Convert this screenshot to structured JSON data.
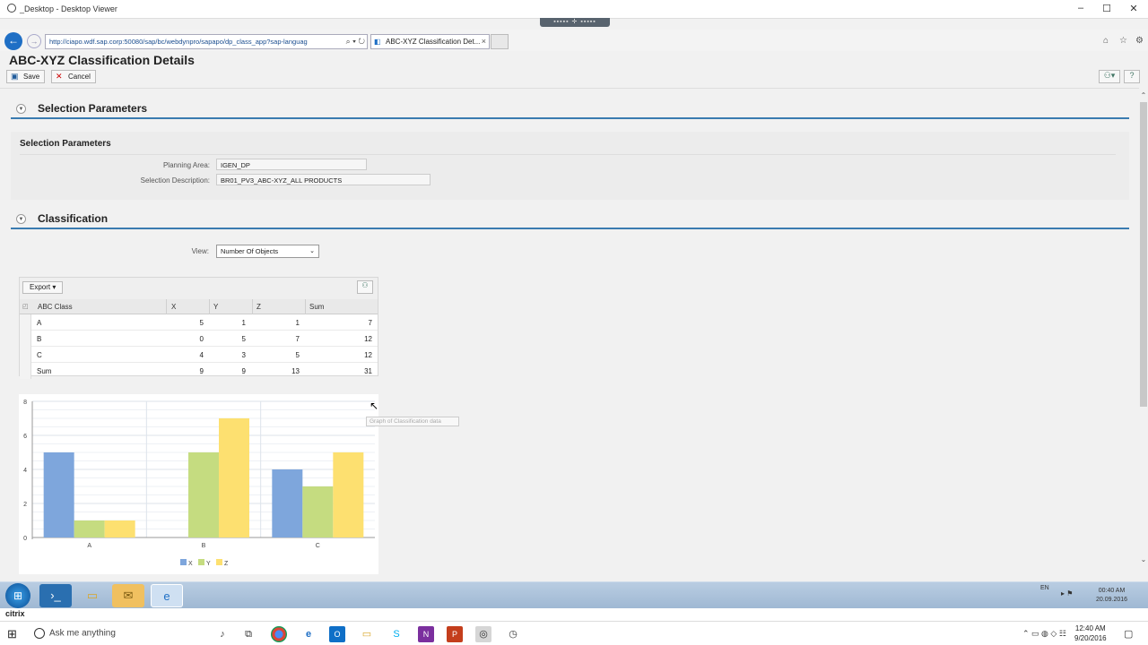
{
  "window": {
    "title": "_Desktop - Desktop Viewer",
    "minimize": "–",
    "maximize": "☐",
    "close": "✕"
  },
  "browser": {
    "url": "http://ciapo.wdf.sap.corp:50080/sap/bc/webdynpro/sapapo/dp_class_app?sap-languag",
    "tab_label": "ABC-XYZ Classification Det...",
    "tab_close": "×"
  },
  "page": {
    "title": "ABC-XYZ Classification Details",
    "toolbar": {
      "save_label": "Save",
      "cancel_label": "Cancel"
    }
  },
  "selection_section": {
    "header": "Selection Parameters",
    "subheader": "Selection Parameters",
    "fields": [
      {
        "label": "Planning Area:",
        "value": "IGEN_DP"
      },
      {
        "label": "Selection Description:",
        "value": "BR01_PV3_ABC-XYZ_ALL PRODUCTS"
      }
    ]
  },
  "classification_section": {
    "header": "Classification",
    "view_label": "View:",
    "view_value": "Number Of Objects",
    "export_label": "Export",
    "table": {
      "columns": [
        "ABC Class",
        "X",
        "Y",
        "Z",
        "Sum"
      ],
      "rows": [
        [
          "A",
          "5",
          "1",
          "1",
          "7"
        ],
        [
          "B",
          "0",
          "5",
          "7",
          "12"
        ],
        [
          "C",
          "4",
          "3",
          "5",
          "12"
        ],
        [
          "Sum",
          "9",
          "9",
          "13",
          "31"
        ]
      ]
    },
    "chart_tooltip": "Graph of Classification data"
  },
  "chart_data": {
    "type": "bar",
    "categories": [
      "A",
      "B",
      "C"
    ],
    "series": [
      {
        "name": "X",
        "values": [
          5,
          0,
          4
        ],
        "color": "#7ea6dc"
      },
      {
        "name": "Y",
        "values": [
          1,
          5,
          3
        ],
        "color": "#c5dc80"
      },
      {
        "name": "Z",
        "values": [
          1,
          7,
          5
        ],
        "color": "#fde070"
      }
    ],
    "ylim": [
      0,
      8
    ],
    "yticks": [
      "0",
      "2",
      "4",
      "6",
      "8"
    ],
    "grid": true,
    "legend_position": "bottom-center"
  },
  "citrix_taskbar": {
    "lang": "EN",
    "time": "00:40 AM",
    "date": "20.09.2016",
    "label": "citrix"
  },
  "windows_taskbar": {
    "search_placeholder": "Ask me anything",
    "time": "12:40 AM",
    "date": "9/20/2016"
  }
}
